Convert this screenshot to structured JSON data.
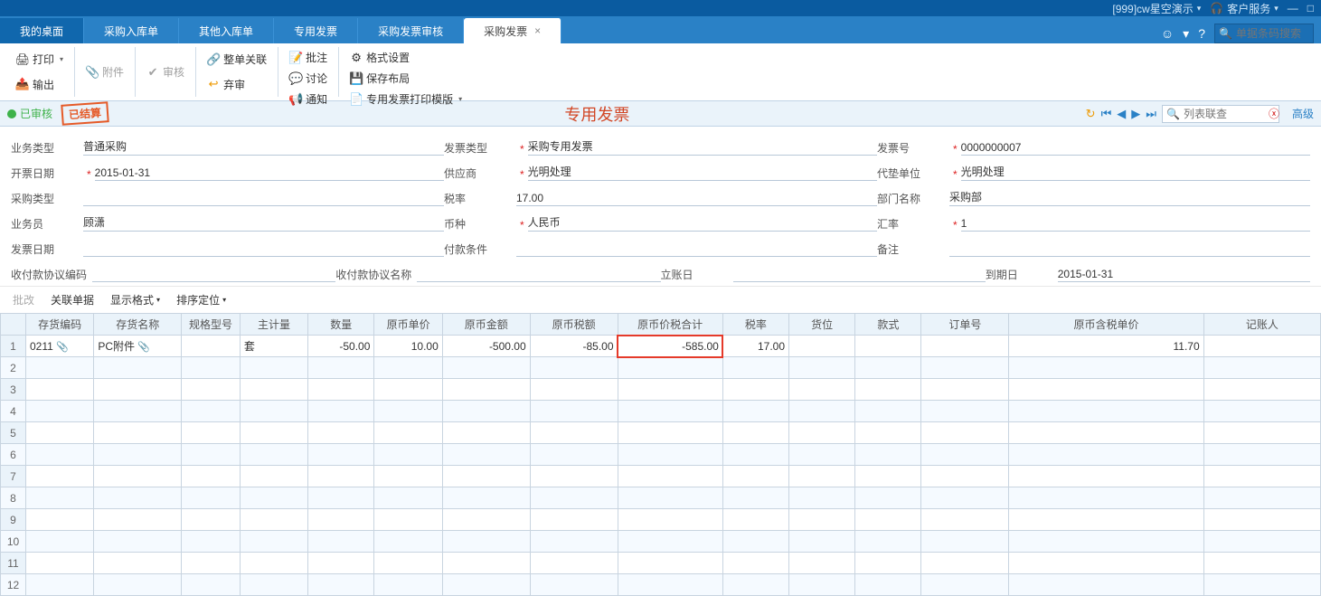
{
  "titlebar": {
    "account": "[999]cw星空演示",
    "service": "客户服务"
  },
  "tabs": {
    "mydesk": "我的桌面",
    "items": [
      "采购入库单",
      "其他入库单",
      "专用发票",
      "采购发票审核"
    ],
    "active": "采购发票"
  },
  "topsearch": {
    "placeholder": "单据条码搜索"
  },
  "toolbar": {
    "print": "打印",
    "export": "输出",
    "attach": "附件",
    "audit": "审核",
    "linkAll": "整单关联",
    "abandon": "弃审",
    "approve": "批注",
    "discuss": "讨论",
    "notify": "通知",
    "format": "格式设置",
    "saveLayout": "保存布局",
    "printTpl": "专用发票打印模版"
  },
  "status": {
    "audited": "已审核",
    "stamp": "已结算",
    "title": "专用发票",
    "listSearch": "列表联查",
    "adv": "高级"
  },
  "form": {
    "bizType_l": "业务类型",
    "bizType": "普通采购",
    "invDate_l": "开票日期",
    "invDate": "2015-01-31",
    "buyType_l": "采购类型",
    "buyType": "",
    "sales_l": "业务员",
    "sales": "顾潇",
    "fpDate_l": "发票日期",
    "fpDate": "",
    "invType_l": "发票类型",
    "invType": "采购专用发票",
    "supplier_l": "供应商",
    "supplier": "光明处理",
    "taxRate_l": "税率",
    "taxRate": "17.00",
    "currency_l": "币种",
    "currency": "人民币",
    "payTerms_l": "付款条件",
    "payTerms": "",
    "invNo_l": "发票号",
    "invNo": "0000000007",
    "advUnit_l": "代垫单位",
    "advUnit": "光明处理",
    "dept_l": "部门名称",
    "dept": "采购部",
    "rate_l": "汇率",
    "rate": "1",
    "memo_l": "备注",
    "memo": "",
    "agreeNo_l": "收付款协议编码",
    "agreeNo": "",
    "agreeName_l": "收付款协议名称",
    "agreeName": "",
    "postDate_l": "立账日",
    "postDate": "",
    "dueDate_l": "到期日",
    "dueDate": "2015-01-31"
  },
  "gridToolbar": {
    "batch": "批改",
    "relate": "关联单据",
    "dispFmt": "显示格式",
    "sortPos": "排序定位"
  },
  "grid": {
    "headers": [
      "",
      "存货编码",
      "存货名称",
      "规格型号",
      "主计量",
      "数量",
      "原币单价",
      "原币金额",
      "原币税额",
      "原币价税合计",
      "税率",
      "货位",
      "款式",
      "订单号",
      "原币含税单价",
      "记账人"
    ],
    "widths": [
      26,
      70,
      90,
      60,
      70,
      68,
      70,
      90,
      90,
      108,
      68,
      68,
      68,
      90,
      200,
      120
    ],
    "rows": [
      {
        "n": 1,
        "code": "0211",
        "name": "PC附件",
        "spec": "",
        "uom": "套",
        "qty": "-50.00",
        "price": "10.00",
        "amt": "-500.00",
        "tax": "-85.00",
        "total": "-585.00",
        "trate": "17.00",
        "loc": "",
        "style": "",
        "order": "",
        "incprice": "11.70",
        "poster": ""
      }
    ],
    "blankRows": 11
  },
  "chart_data": {
    "type": "table",
    "title": "专用发票",
    "columns": [
      "存货编码",
      "存货名称",
      "规格型号",
      "主计量",
      "数量",
      "原币单价",
      "原币金额",
      "原币税额",
      "原币价税合计",
      "税率",
      "货位",
      "款式",
      "订单号",
      "原币含税单价",
      "记账人"
    ],
    "rows": [
      [
        "0211",
        "PC附件",
        "",
        "套",
        -50.0,
        10.0,
        -500.0,
        -85.0,
        -585.0,
        17.0,
        "",
        "",
        "",
        11.7,
        ""
      ]
    ]
  }
}
